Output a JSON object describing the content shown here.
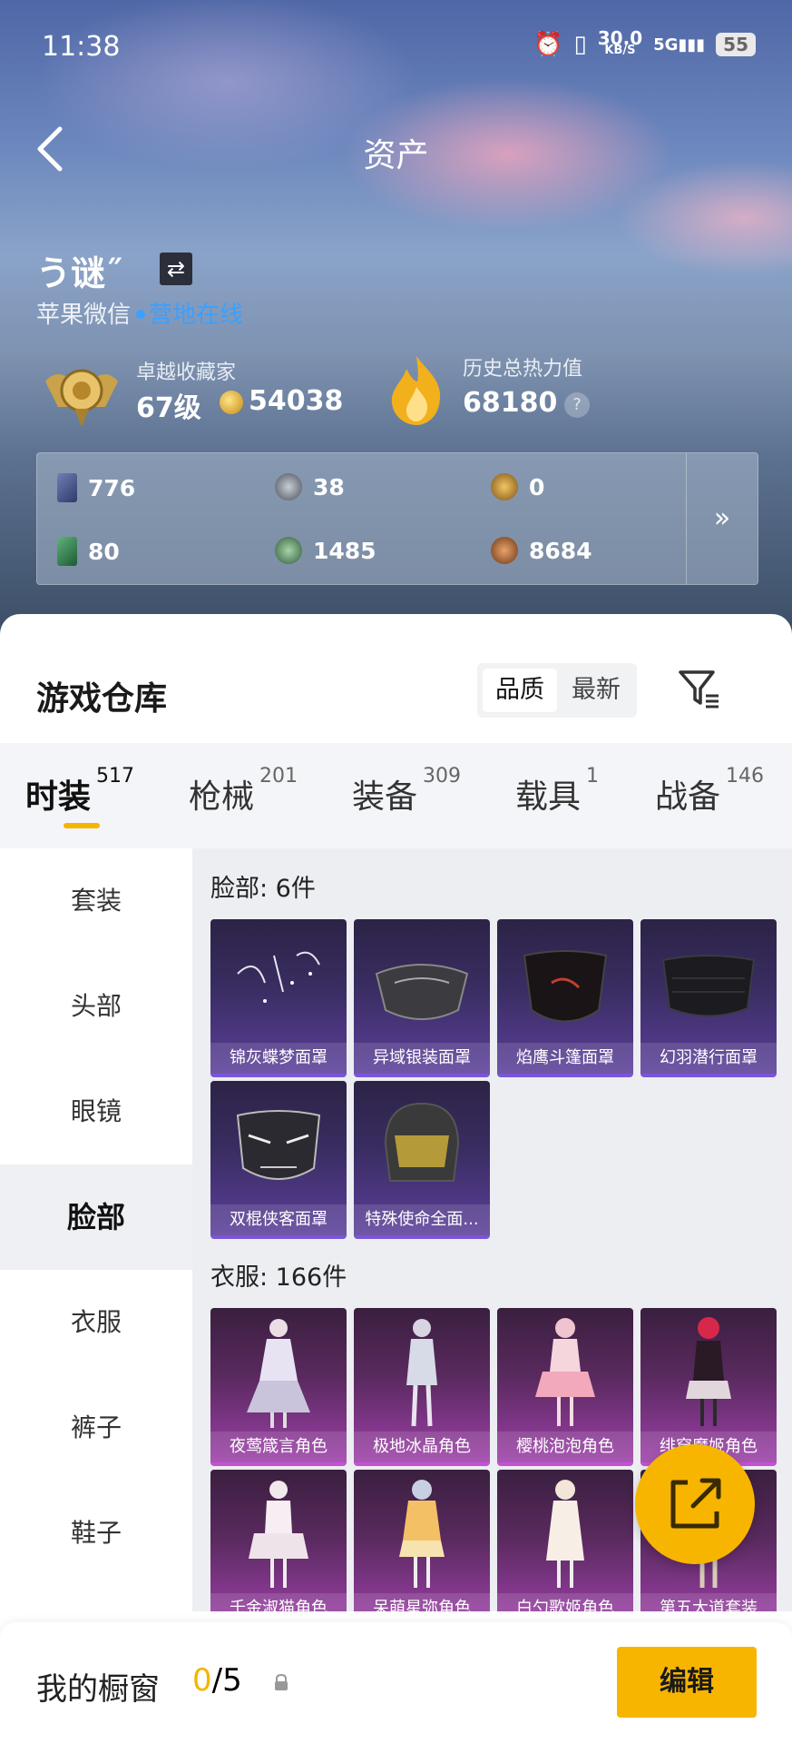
{
  "status_bar": {
    "time": "11:38",
    "net_speed": "30.0",
    "net_unit": "KB/S",
    "signal": "5G",
    "battery": "55"
  },
  "header": {
    "title": "资产"
  },
  "profile": {
    "name": "う谜˝",
    "platform": "苹果微信",
    "status": "营地在线",
    "collector_label": "卓越收藏家",
    "collector_level": "67级",
    "collector_coins": "54038",
    "heat_label": "历史总热力值",
    "heat_value": "68180",
    "help_icon": "?"
  },
  "resources": {
    "items": [
      {
        "icon": "card-icon",
        "value": "776"
      },
      {
        "icon": "silver-coin-icon",
        "value": "38"
      },
      {
        "icon": "gold-emblem-icon",
        "value": "0"
      },
      {
        "icon": "green-card-icon",
        "value": "80"
      },
      {
        "icon": "green-coin-icon",
        "value": "1485"
      },
      {
        "icon": "bronze-coin-icon",
        "value": "8684"
      }
    ],
    "more": "»"
  },
  "warehouse": {
    "title": "游戏仓库",
    "sort_quality": "品质",
    "sort_newest": "最新"
  },
  "tabs": [
    {
      "label": "时装",
      "count": "517",
      "active": true
    },
    {
      "label": "枪械",
      "count": "201"
    },
    {
      "label": "装备",
      "count": "309"
    },
    {
      "label": "载具",
      "count": "1"
    },
    {
      "label": "战备",
      "count": "146"
    }
  ],
  "sidebar": {
    "items": [
      {
        "label": "套装"
      },
      {
        "label": "头部"
      },
      {
        "label": "眼镜"
      },
      {
        "label": "脸部",
        "active": true
      },
      {
        "label": "衣服"
      },
      {
        "label": "裤子"
      },
      {
        "label": "鞋子"
      }
    ]
  },
  "sections": [
    {
      "title": "脸部: 6件",
      "items": [
        "锦灰蝶梦面罩",
        "异域银装面罩",
        "焰鹰斗篷面罩",
        "幻羽潜行面罩",
        "双棍侠客面罩",
        "特殊使命全面..."
      ]
    },
    {
      "title": "衣服: 166件",
      "items": [
        "夜莺箴言角色",
        "极地冰晶角色",
        "樱桃泡泡角色",
        "绯穿魔姬角色",
        "千金淑猫角色",
        "呆萌星弥角色",
        "白勺歌姬角色",
        "第五大道套装"
      ]
    }
  ],
  "bottom_bar": {
    "label": "我的橱窗",
    "count_current": "0",
    "count_total": "/5",
    "edit_label": "编辑"
  },
  "colors": {
    "accent": "#f7b500",
    "online": "#3aa0ff",
    "rare_purple": "#7a55d8",
    "rare_pink": "#c64fd6"
  }
}
